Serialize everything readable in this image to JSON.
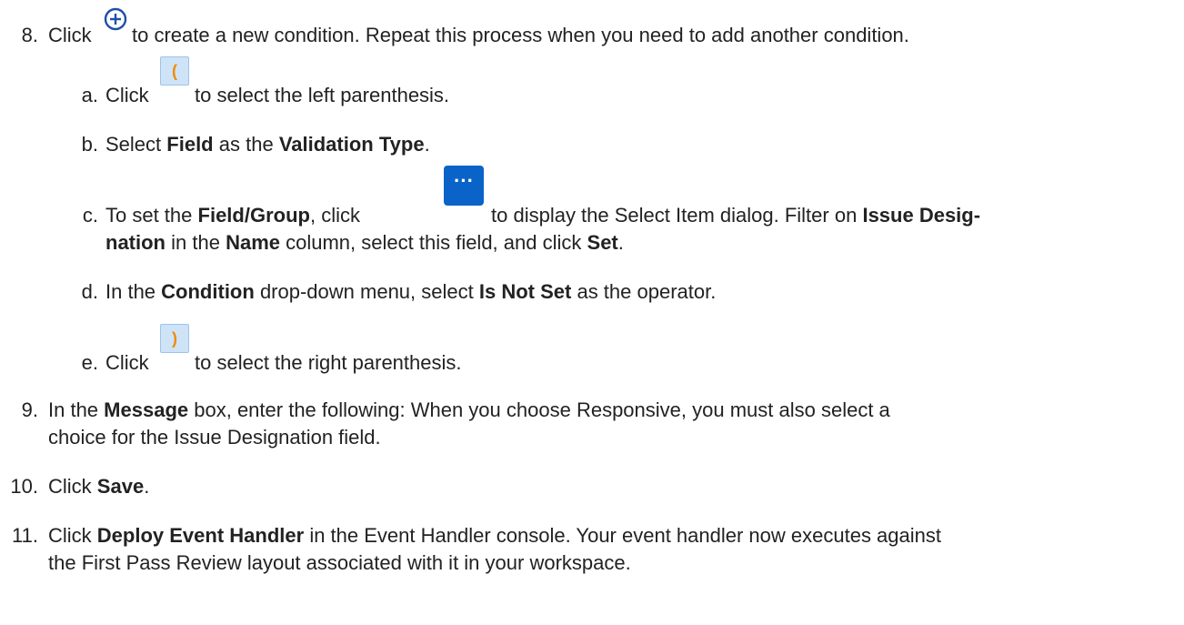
{
  "steps": {
    "step8": {
      "number": "8.",
      "click": "Click",
      "text": "to create a new condition. Repeat this process when you need to add another condition.",
      "icon": "add-circle-icon",
      "substeps": {
        "a": {
          "marker": "a.",
          "click": "Click",
          "text": "to select the left parenthesis.",
          "icon": "left-parenthesis-icon",
          "icon_glyph": "("
        },
        "b": {
          "marker": "b.",
          "pre": "Select",
          "bold1": "Field",
          "mid": "as the",
          "bold2": "Validation Type",
          "post": "."
        },
        "c": {
          "marker": "c.",
          "pre": "To set the",
          "bold1": "Field/Group",
          "mid1": ", click",
          "icon": "ellipsis-button-icon",
          "icon_glyph": "···",
          "mid2": "to display the Select Item dialog. Filter on",
          "bold2": "Issue Desig-",
          "bold3": "nation",
          "mid3": "in the",
          "bold4": "Name",
          "mid4": "column, select this field, and click",
          "bold5": "Set",
          "post": "."
        },
        "d": {
          "marker": "d.",
          "pre": "In the",
          "bold1": "Condition",
          "mid": "drop-down menu, select",
          "bold2": "Is Not Set",
          "post": "as the operator."
        },
        "e": {
          "marker": "e.",
          "click": "Click",
          "text": "to select the right parenthesis.",
          "icon": "right-parenthesis-icon",
          "icon_glyph": ")"
        }
      }
    },
    "step9": {
      "number": "9.",
      "pre": "In the",
      "bold": "Message",
      "line1": "box, enter the following: When you choose Responsive, you must also select a",
      "line2": "choice for the Issue Designation field."
    },
    "step10": {
      "number": "10.",
      "pre": "Click",
      "bold": "Save",
      "post": "."
    },
    "step11": {
      "number": "11.",
      "pre": "Click",
      "bold": "Deploy Event Handler",
      "line1": "in the Event Handler console. Your event handler now executes against",
      "line2": "the First Pass Review layout associated with it in your workspace."
    }
  },
  "colors": {
    "text": "#222222",
    "add_icon": "#1f4fa8",
    "paren_icon_bg": "#cfe3f7",
    "paren_glyph": "#f08a00",
    "ellipsis_bg": "#0a63c9"
  }
}
